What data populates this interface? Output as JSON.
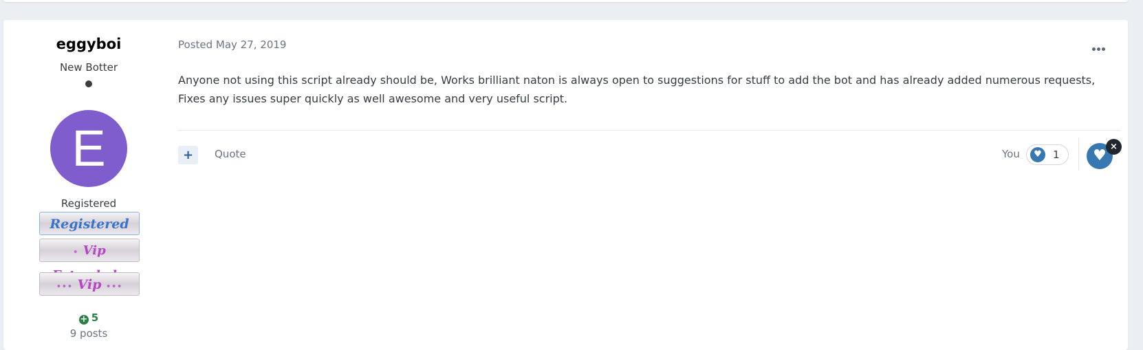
{
  "author": {
    "name": "eggyboi",
    "rank": "New Botter",
    "avatar_letter": "E",
    "avatar_color": "#7f5dcc",
    "group": "Registered",
    "badges": [
      "Registered",
      "Vip Extended",
      "Vip"
    ],
    "reputation": "5",
    "posts": "9 posts"
  },
  "post": {
    "posted_label": "Posted May 27, 2019",
    "content": "Anyone not using this script already should be, Works brilliant naton is always open to suggestions for stuff to add the bot and has already added numerous requests, Fixes any issues super quickly as well awesome and very useful script."
  },
  "actions": {
    "multiquote_icon": "+",
    "quote_label": "Quote",
    "you_label": "You",
    "reaction_count": "1",
    "close_icon": "×"
  },
  "icons": {
    "online": "status-dot-icon",
    "more": "ellipsis-icon",
    "heart": "heart-icon",
    "plus": "plus-circle-icon",
    "close": "close-icon"
  },
  "colors": {
    "accent": "#3778b1",
    "reputation": "#2b8046",
    "badge_registered": "#3974c9",
    "badge_vip": "#b644c4"
  }
}
